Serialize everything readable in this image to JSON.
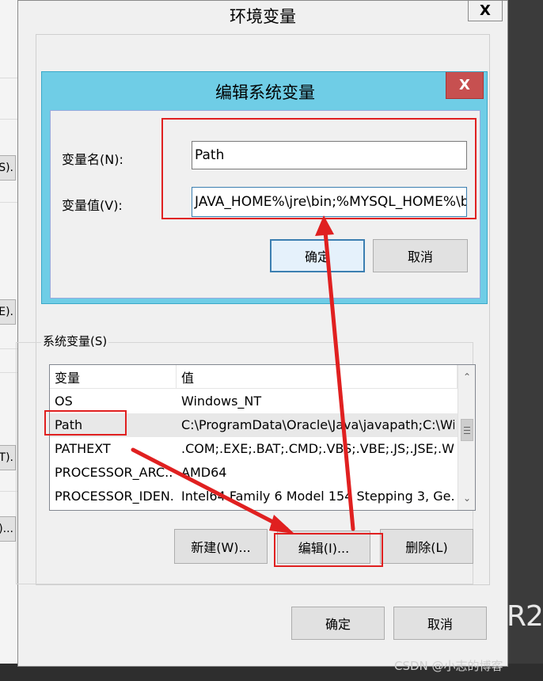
{
  "background": {
    "left_buttons": [
      "S).",
      "E).",
      "T).",
      ")..."
    ],
    "corner_text": "R2",
    "watermark": "CSDN @小志的博客"
  },
  "main_dialog": {
    "title": "环境变量",
    "close_glyph": "X",
    "system_vars_label": "系统变量(S)",
    "columns": [
      "变量",
      "值"
    ],
    "rows": [
      {
        "name": "OS",
        "value": "Windows_NT"
      },
      {
        "name": "Path",
        "value": "C:\\ProgramData\\Oracle\\Java\\javapath;C:\\Wi..."
      },
      {
        "name": "PATHEXT",
        "value": ".COM;.EXE;.BAT;.CMD;.VBS;.VBE;.JS;.JSE;.WSF;...."
      },
      {
        "name": "PROCESSOR_ARC...",
        "value": "AMD64"
      },
      {
        "name": "PROCESSOR_IDEN...",
        "value": "Intel64 Family 6 Model 154 Stepping 3, Ge..."
      }
    ],
    "selected_row": "Path",
    "buttons": {
      "new": "新建(W)...",
      "edit": "编辑(I)...",
      "delete": "删除(L)"
    },
    "ok": "确定",
    "cancel": "取消"
  },
  "edit_dialog": {
    "title": "编辑系统变量",
    "close_glyph": "X",
    "name_label": "变量名(N):",
    "name_value": "Path",
    "value_label": "变量值(V):",
    "value_value": "JAVA_HOME%\\jre\\bin;%MYSQL_HOME%\\bin;",
    "ok": "确定",
    "cancel": "取消"
  },
  "colors": {
    "annotation": "#e02020",
    "edit_titlebar": "#6fcde6",
    "edit_close": "#c75050"
  }
}
